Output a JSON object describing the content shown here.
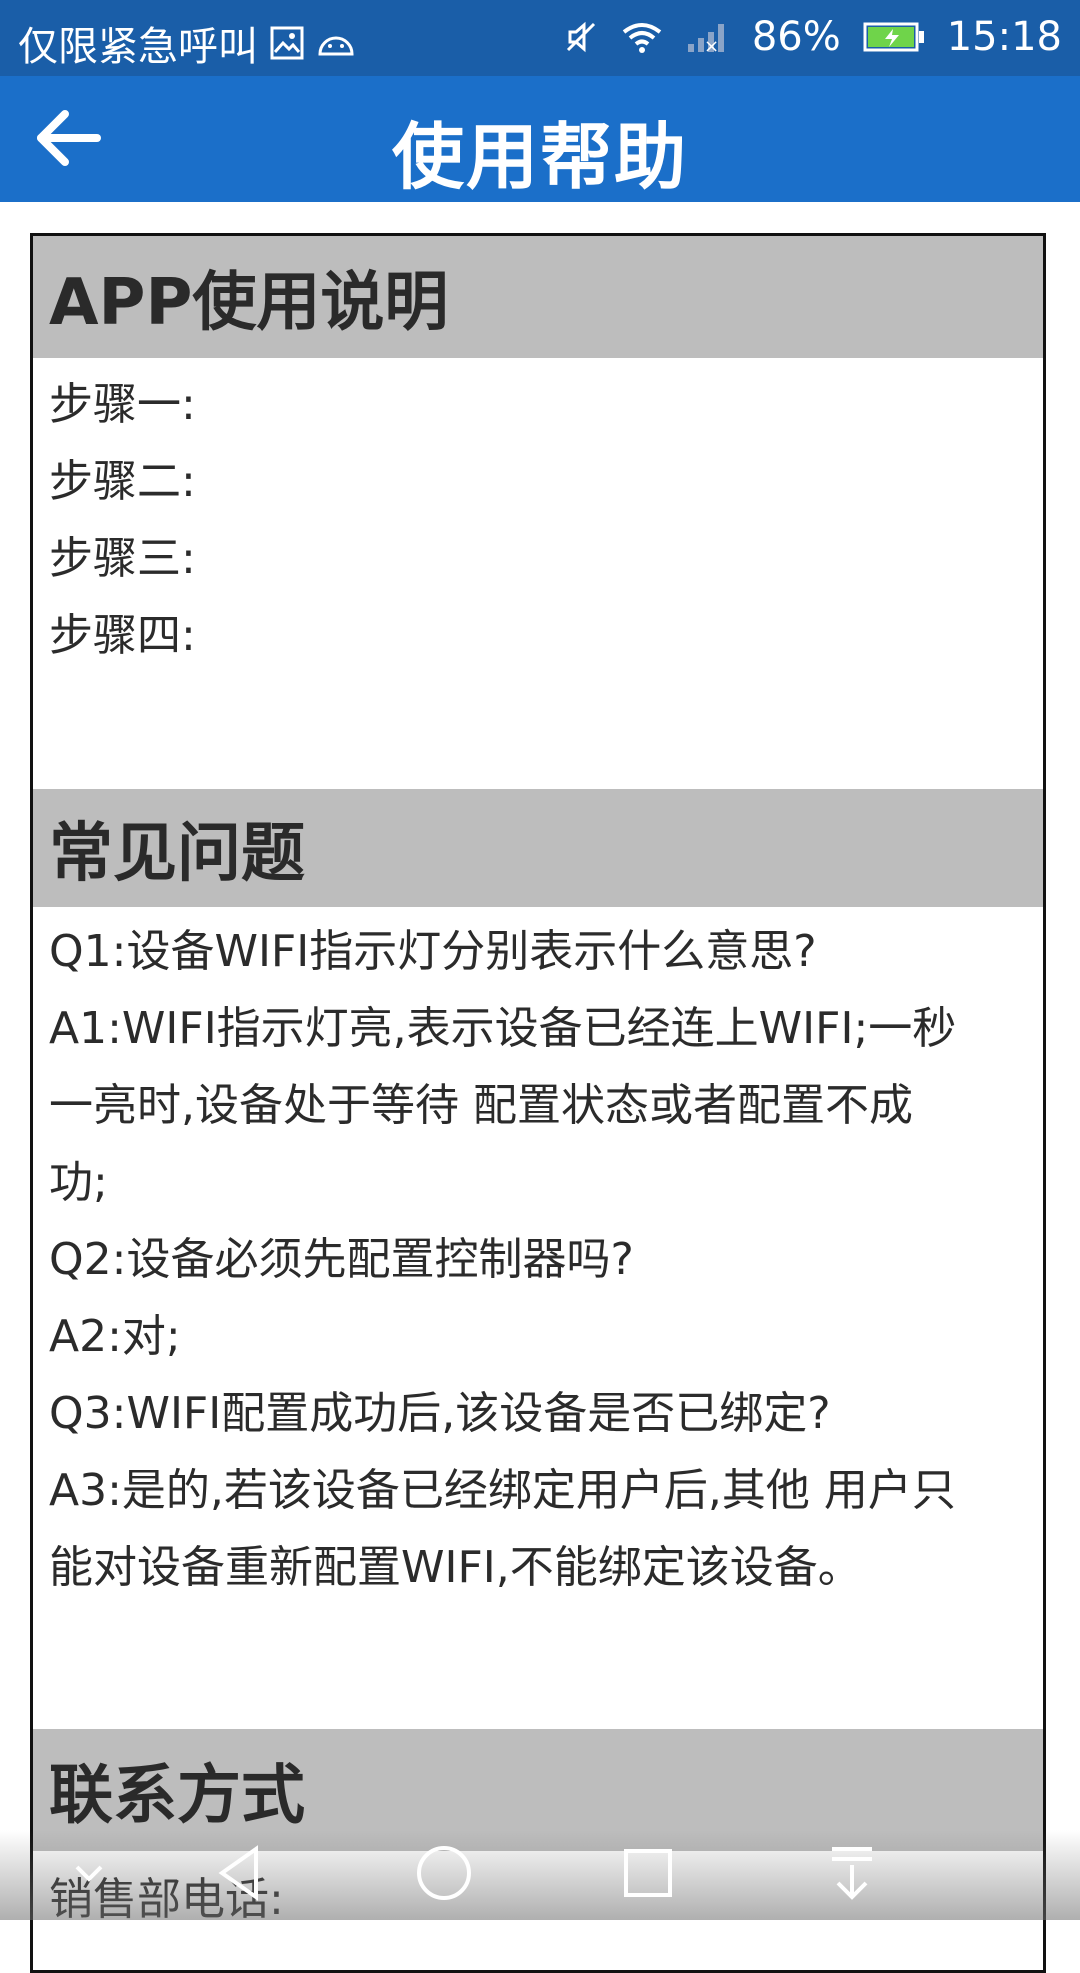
{
  "status_bar": {
    "carrier": "仅限紧急呼叫",
    "battery_percent": "86%",
    "time": "15:18",
    "icons": [
      "gallery-icon",
      "android-icon",
      "mute-icon",
      "wifi-icon",
      "signal-icon",
      "battery-icon"
    ]
  },
  "header": {
    "title": "使用帮助",
    "back_icon": "arrow-left-icon",
    "bg_color": "#1b6fc9"
  },
  "sections": {
    "usage": {
      "title": "APP使用说明",
      "steps": [
        "步骤一:",
        "步骤二:",
        "步骤三:",
        "步骤四:"
      ]
    },
    "faq": {
      "title": "常见问题",
      "lines": [
        "Q1:设备WIFI指示灯分别表示什么意思?",
        "A1:WIFI指示灯亮,表示设备已经连上WIFI;一秒",
        "一亮时,设备处于等待 配置状态或者配置不成",
        "功;",
        "Q2:设备必须先配置控制器吗?",
        "A2:对;",
        "Q3:WIFI配置成功后,该设备是否已绑定?",
        "A3:是的,若该设备已经绑定用户后,其他 用户只",
        "能对设备重新配置WIFI,不能绑定该设备。"
      ]
    },
    "contact": {
      "title": "联系方式",
      "sales_phone_label": "销售部电话:"
    }
  },
  "nav_bar": {
    "buttons": [
      "chevron-down-icon",
      "back-triangle-icon",
      "home-circle-icon",
      "recents-square-icon",
      "pull-down-icon"
    ]
  }
}
